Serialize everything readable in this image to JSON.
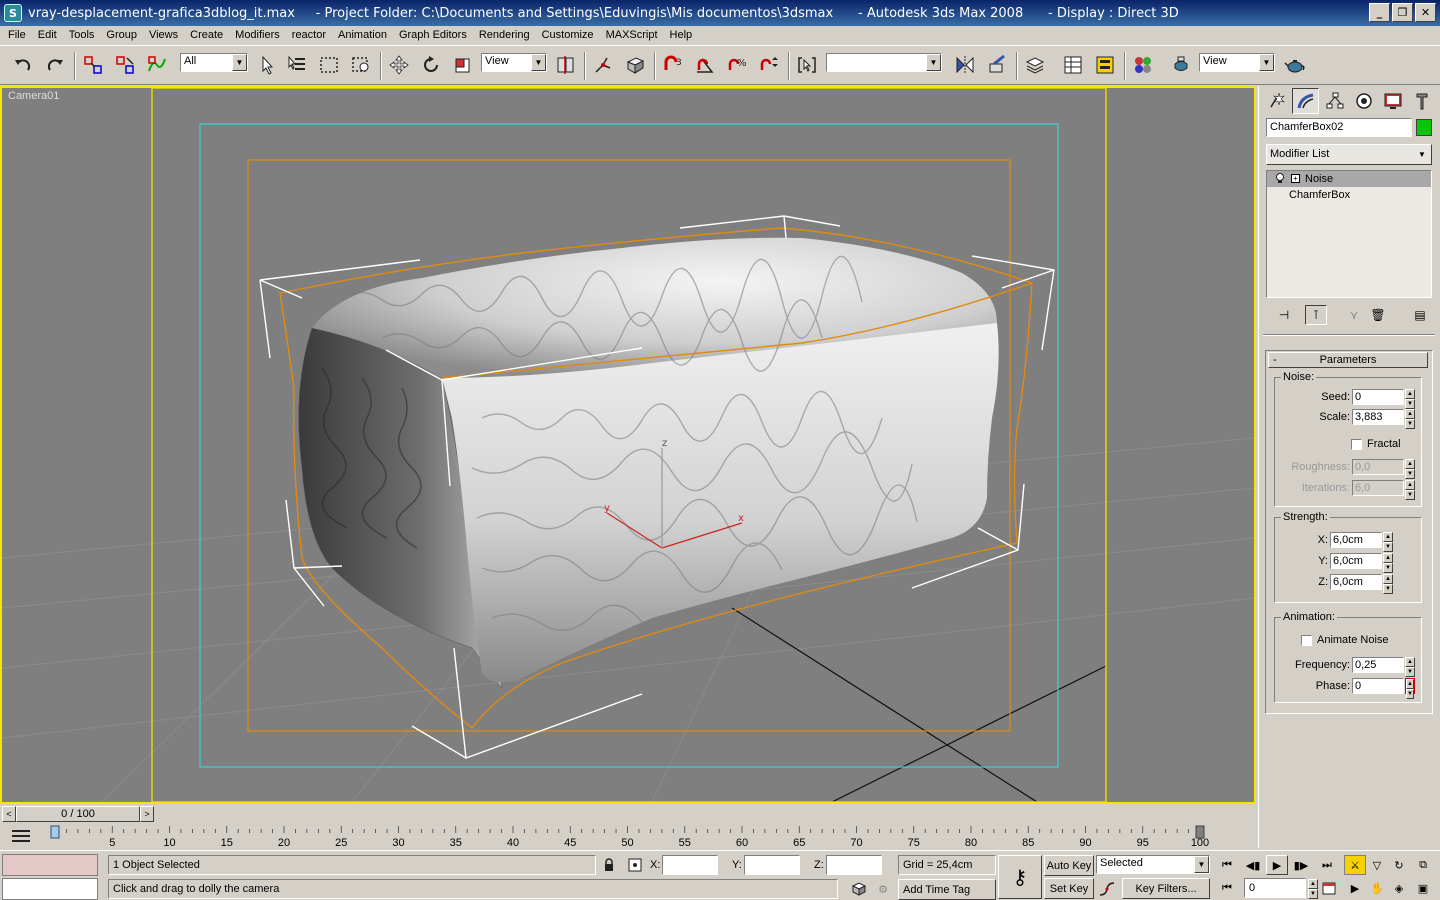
{
  "window": {
    "title": "vray-desplacement-grafica3dblog_it.max     - Project Folder: C:\\Documents and Settings\\Eduvingis\\Mis documentos\\3dsmax      - Autodesk 3ds Max 2008      - Display : Direct 3D",
    "app_icon_letter": "S",
    "minimize": "_",
    "maximize": "❐",
    "close": "✕"
  },
  "menu": [
    "File",
    "Edit",
    "Tools",
    "Group",
    "Views",
    "Create",
    "Modifiers",
    "reactor",
    "Animation",
    "Graph Editors",
    "Rendering",
    "Customize",
    "MAXScript",
    "Help"
  ],
  "toolbar": {
    "selection_filter": "All",
    "reference_coord": "View",
    "named_selection": "",
    "render_view": "View"
  },
  "viewport": {
    "label": "Camera01",
    "axis_x": "x",
    "axis_y": "y",
    "axis_z": "z",
    "border_color": "#f7e400",
    "background": "#7f7f7f"
  },
  "command_panel": {
    "object_name": "ChamferBox02",
    "object_color": "#0cc40c",
    "modifier_list": "Modifier List",
    "stack": [
      {
        "label": "Noise",
        "selected": true
      },
      {
        "label": "ChamferBox",
        "selected": false
      }
    ],
    "parameters": {
      "title": "Parameters",
      "collapse": "-",
      "noise_group": "Noise:",
      "seed_label": "Seed:",
      "seed": "0",
      "scale_label": "Scale:",
      "scale": "3,883",
      "fractal_label": "Fractal",
      "roughness_label": "Roughness:",
      "roughness": "0,0",
      "iterations_label": "Iterations:",
      "iterations": "6,0",
      "strength_group": "Strength:",
      "x_label": "X:",
      "x": "6,0cm",
      "y_label": "Y:",
      "y": "6,0cm",
      "z_label": "Z:",
      "z": "6,0cm",
      "animation_group": "Animation:",
      "animate_noise_label": "Animate Noise",
      "frequency_label": "Frequency:",
      "frequency": "0,25",
      "phase_label": "Phase:",
      "phase": "0"
    }
  },
  "timeline": {
    "frame_display": "0 / 100",
    "prev": "<",
    "next": ">",
    "ticks": [
      "5",
      "10",
      "15",
      "20",
      "25",
      "30",
      "35",
      "40",
      "45",
      "50",
      "55",
      "60",
      "65",
      "70",
      "75",
      "80",
      "85",
      "90",
      "95",
      "100"
    ]
  },
  "status": {
    "selection": "1 Object Selected",
    "prompt": "Click and drag to dolly the camera",
    "x_label": "X:",
    "y_label": "Y:",
    "z_label": "Z:",
    "x_value": "",
    "y_value": "",
    "z_value": "",
    "grid": "Grid = 25,4cm",
    "add_time_tag": "Add Time Tag",
    "auto_key": "Auto Key",
    "set_key": "Set Key",
    "key_mode": "Selected",
    "key_filters": "Key Filters...",
    "current_frame": "0"
  }
}
